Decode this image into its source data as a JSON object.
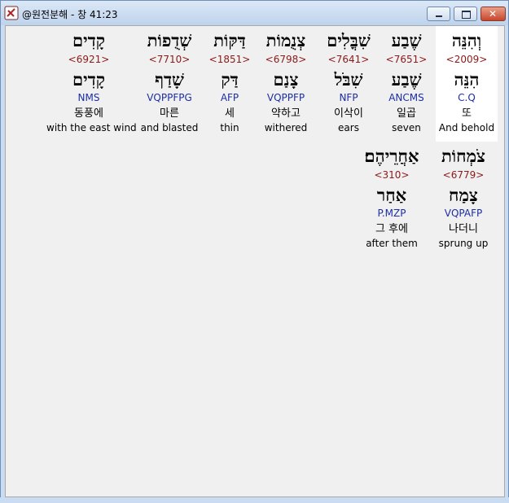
{
  "window": {
    "title": "@원전분해 - 창 41:23",
    "minimize_label": "",
    "maximize_label": "",
    "close_label": "✕"
  },
  "colors": {
    "strong_number": "#8b1a1a",
    "morphology": "#1d2ea3",
    "selected_bg": "#ffffff"
  },
  "words": [
    {
      "surface": "וְהִנֵּה",
      "strong": "<2009>",
      "lemma": "הִנֵּה",
      "morph": "C.Q",
      "korean": "또",
      "english": "And behold"
    },
    {
      "surface": "שֶׁבַע",
      "strong": "<7651>",
      "lemma": "שֶׁבַע",
      "morph": "ANCMS",
      "korean": "일곱",
      "english": "seven"
    },
    {
      "surface": "שִׁבֳּלִים",
      "strong": "<7641>",
      "lemma": "שִׁבֹּל",
      "morph": "NFP",
      "korean": "이삭이",
      "english": "ears"
    },
    {
      "surface": "צְנֻמוֹת",
      "strong": "<6798>",
      "lemma": "צָנַם",
      "morph": "VQPPFP",
      "korean": "약하고",
      "english": "withered"
    },
    {
      "surface": "דַּקּוֹת",
      "strong": "<1851>",
      "lemma": "דַּק",
      "morph": "AFP",
      "korean": "세",
      "english": "thin"
    },
    {
      "surface": "שְׁדֻפוֹת",
      "strong": "<7710>",
      "lemma": "שָׁדַף",
      "morph": "VQPPFPG",
      "korean": "마른",
      "english": "and blasted"
    },
    {
      "surface": "קָדִים",
      "strong": "<6921>",
      "lemma": "קָדִים",
      "morph": "NMS",
      "korean": "동풍에",
      "english": "with the east wind"
    },
    {
      "surface": "צֹמְחוֹת",
      "strong": "<6779>",
      "lemma": "צָמַח",
      "morph": "VQPAFP",
      "korean": "나더니",
      "english": "sprung up"
    },
    {
      "surface": "אַחֲרֵיהֶם׃",
      "strong": "<310>",
      "lemma": "אַחַר",
      "morph": "P.MZP",
      "korean": "그 후에",
      "english": "after them"
    }
  ]
}
